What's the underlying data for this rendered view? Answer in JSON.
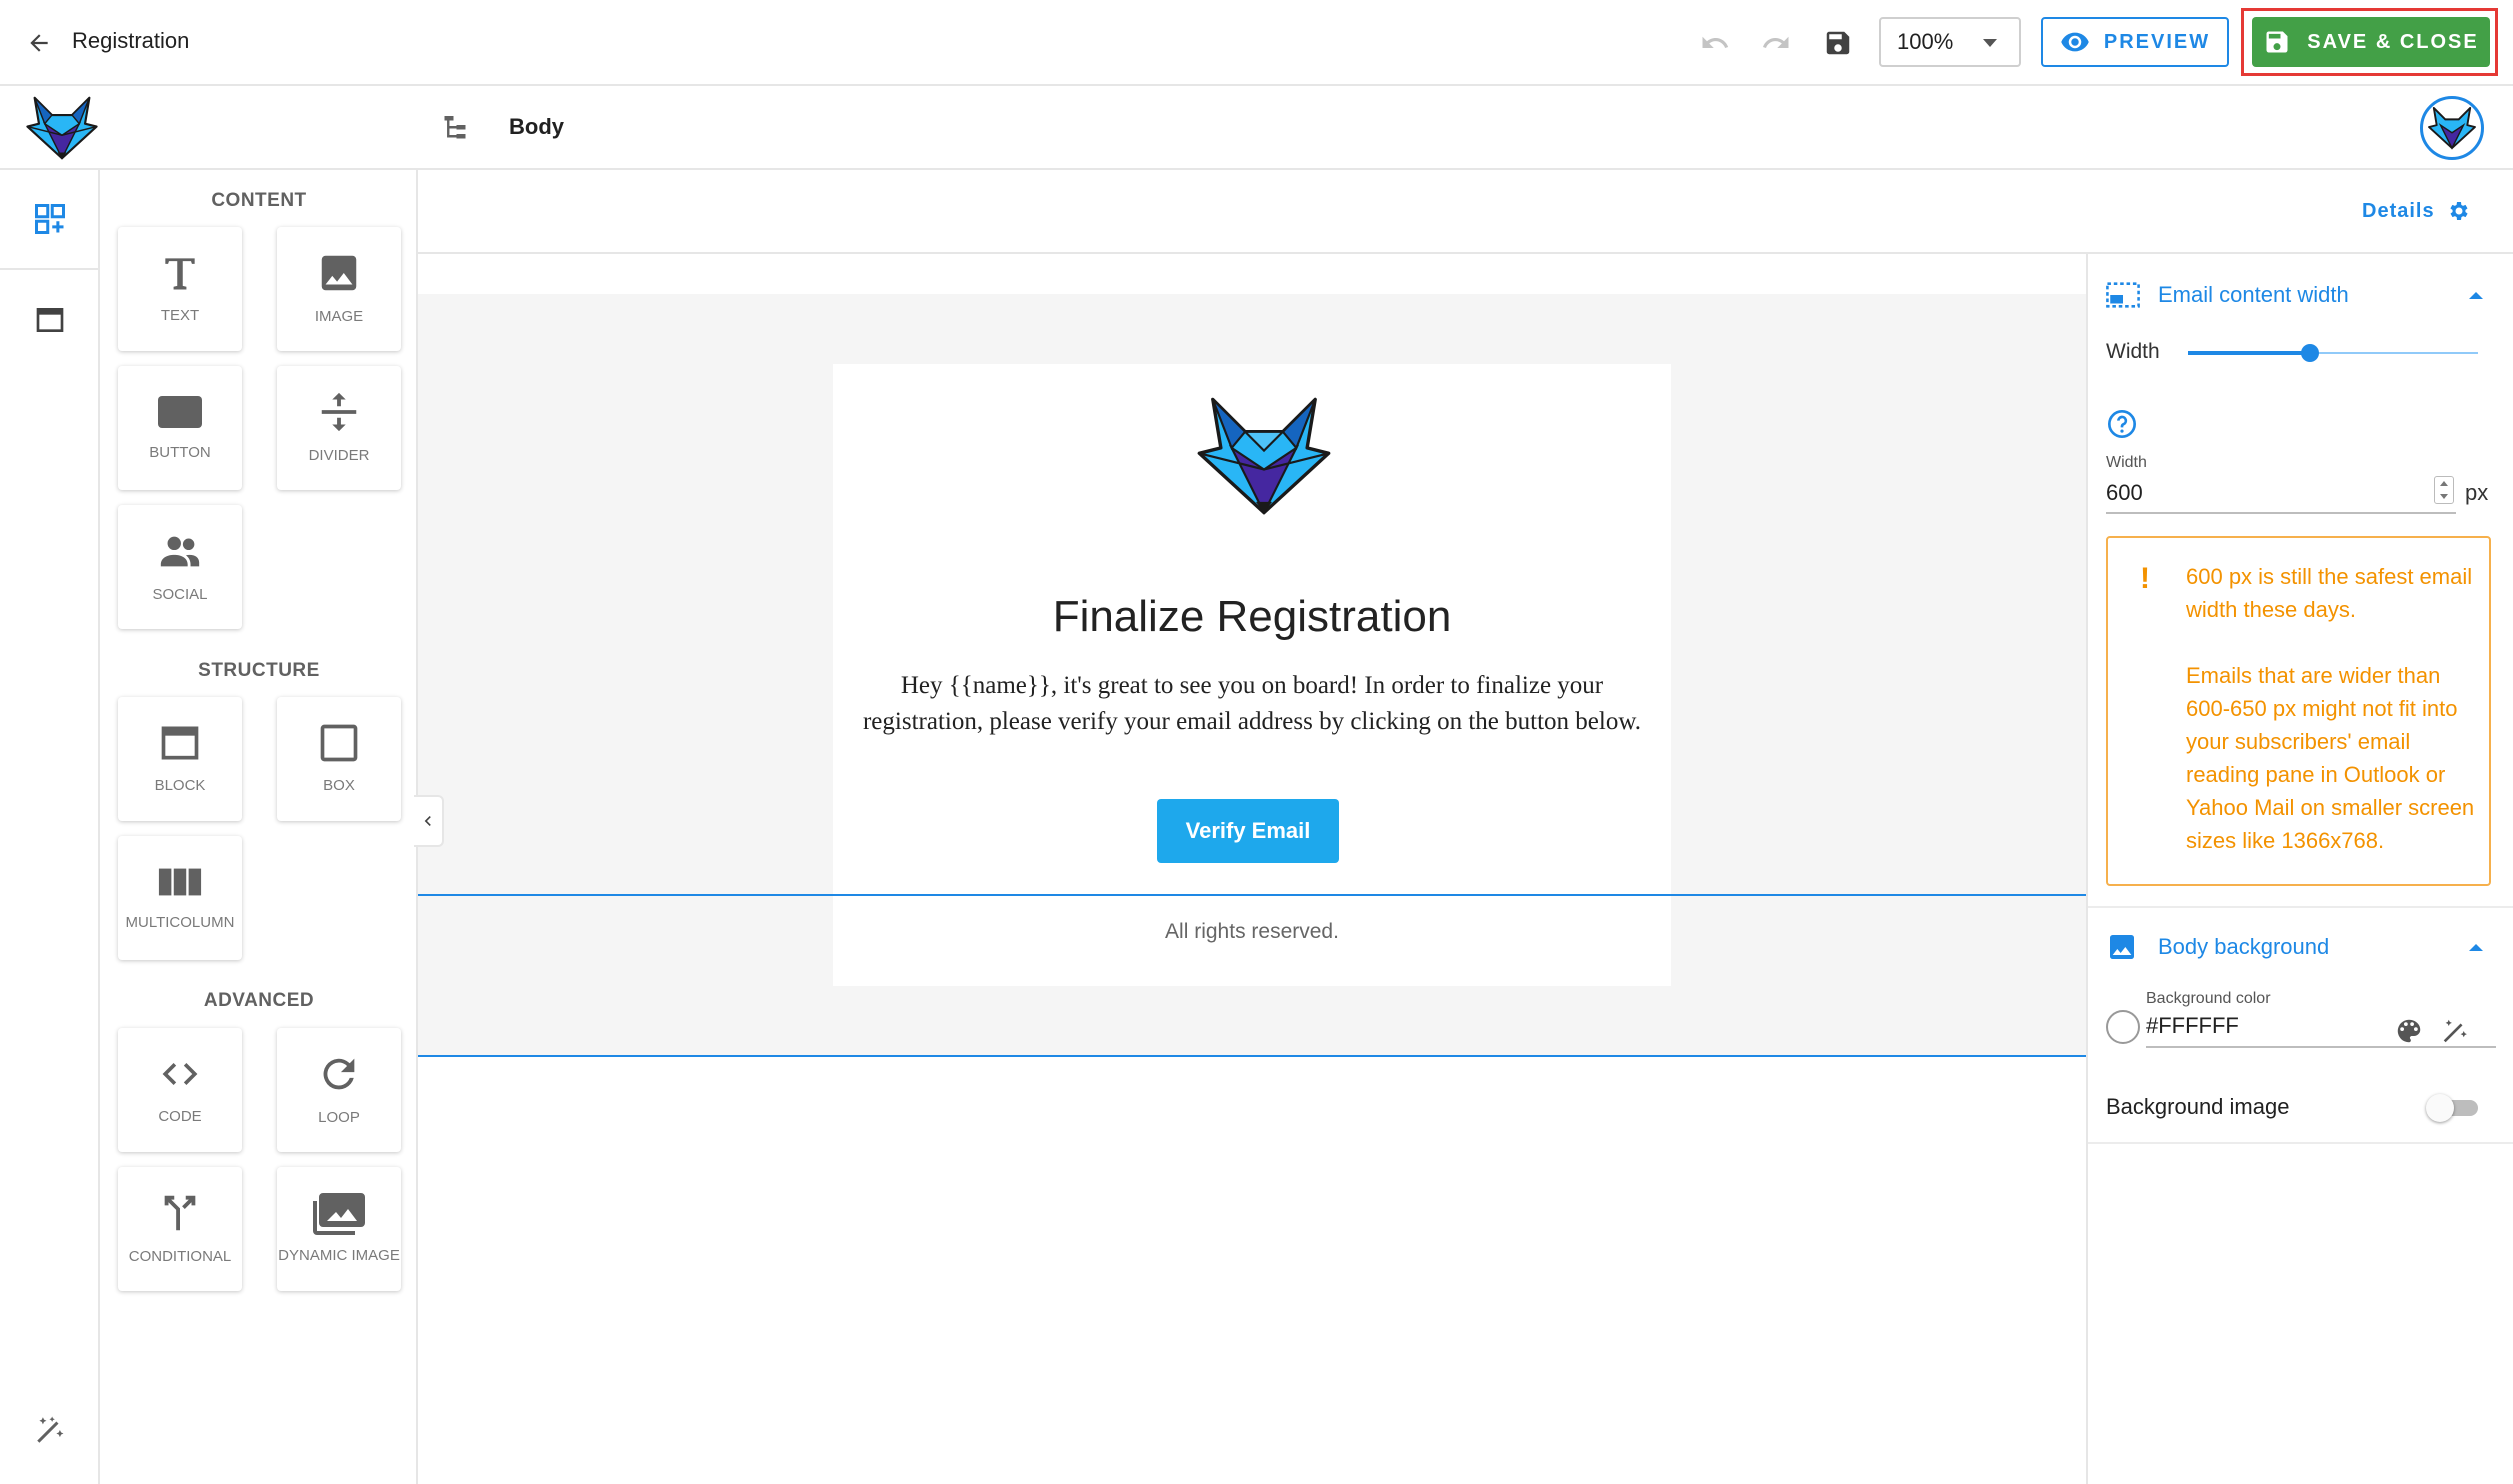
{
  "header": {
    "title": "Registration",
    "zoom": "100%",
    "preview_label": "PREVIEW",
    "save_close_label": "SAVE & CLOSE"
  },
  "breadcrumb": {
    "current": "Body"
  },
  "panel": {
    "sections": {
      "content": "CONTENT",
      "structure": "STRUCTURE",
      "advanced": "ADVANCED"
    },
    "content_items": [
      {
        "label": "TEXT",
        "icon": "text-icon"
      },
      {
        "label": "IMAGE",
        "icon": "image-icon"
      },
      {
        "label": "BUTTON",
        "icon": "button-icon"
      },
      {
        "label": "DIVIDER",
        "icon": "divider-icon"
      },
      {
        "label": "SOCIAL",
        "icon": "social-icon"
      }
    ],
    "structure_items": [
      {
        "label": "BLOCK",
        "icon": "block-icon"
      },
      {
        "label": "BOX",
        "icon": "box-icon"
      },
      {
        "label": "MULTICOLUMN",
        "icon": "multicolumn-icon"
      }
    ],
    "advanced_items": [
      {
        "label": "CODE",
        "icon": "code-icon"
      },
      {
        "label": "LOOP",
        "icon": "loop-icon"
      },
      {
        "label": "CONDITIONAL",
        "icon": "conditional-icon"
      },
      {
        "label": "DYNAMIC IMAGE",
        "icon": "dynamic-image-icon"
      }
    ]
  },
  "canvas": {
    "details_label": "Details"
  },
  "email": {
    "title": "Finalize Registration",
    "body": "Hey {{name}}, it's great to see you on board! In order to finalize your registration, please verify your email address by clicking on the button below.",
    "button": "Verify Email",
    "footer": "All rights reserved."
  },
  "settings": {
    "content_width": {
      "title": "Email content width",
      "slider_label": "Width",
      "slider_fraction": 0.42,
      "field_label": "Width",
      "value": "600",
      "unit": "px",
      "warning": "600 px is still the safest email width these days.\n\nEmails that are wider than 600-650 px might not fit into your subscribers' email reading pane in Outlook or Yahoo Mail on smaller screen sizes like 1366x768."
    },
    "body_background": {
      "title": "Body background",
      "color_label": "Background color",
      "color_value": "#FFFFFF",
      "image_label": "Background image",
      "image_enabled": false
    }
  },
  "colors": {
    "accent": "#1e88e5",
    "save": "#43a047",
    "warning": "#f39200",
    "highlight": "#e53935",
    "button": "#1ea8ec"
  }
}
